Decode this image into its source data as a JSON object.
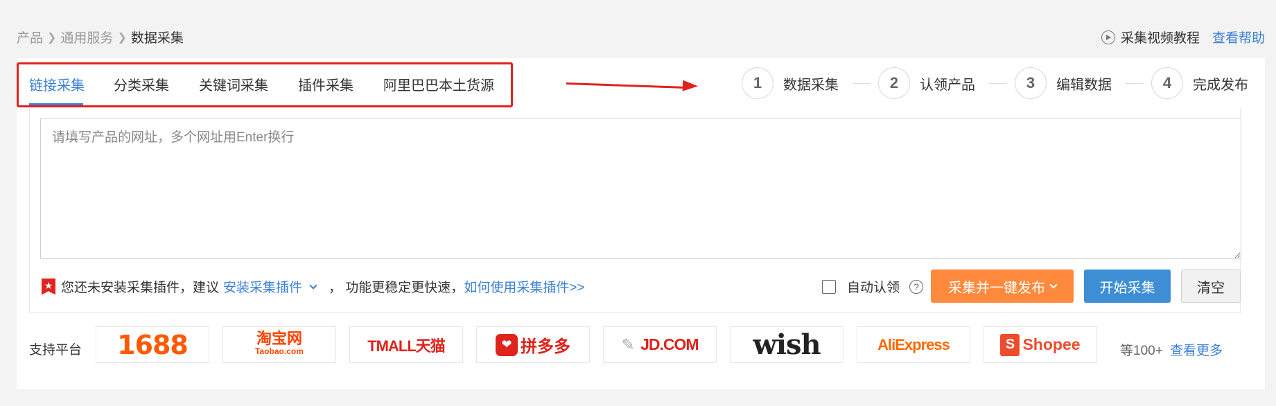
{
  "breadcrumb": {
    "items": [
      "产品",
      "通用服务"
    ],
    "current": "数据采集"
  },
  "header": {
    "tutorial_label": "采集视频教程",
    "help_label": "查看帮助"
  },
  "tabs": [
    {
      "label": "链接采集",
      "active": true
    },
    {
      "label": "分类采集",
      "active": false
    },
    {
      "label": "关键词采集",
      "active": false
    },
    {
      "label": "插件采集",
      "active": false
    },
    {
      "label": "阿里巴巴本土货源",
      "active": false
    }
  ],
  "steps": [
    {
      "number": "1",
      "label": "数据采集"
    },
    {
      "number": "2",
      "label": "认领产品"
    },
    {
      "number": "3",
      "label": "编辑数据"
    },
    {
      "number": "4",
      "label": "完成发布"
    }
  ],
  "url_input": {
    "placeholder": "请填写产品的网址，多个网址用Enter换行",
    "value": ""
  },
  "plugin_notice": {
    "prefix": "您还未安装采集插件，建议",
    "install_link": "安装采集插件",
    "middle": "，  功能更稳定更快速，",
    "howto_link": "如何使用采集插件>>"
  },
  "auto_claim": {
    "label": "自动认领",
    "checked": false
  },
  "buttons": {
    "collect_publish": "采集并一键发布",
    "start": "开始采集",
    "clear": "清空"
  },
  "platforms": {
    "label": "支持平台",
    "items": [
      {
        "name": "1688"
      },
      {
        "name": "淘宝网",
        "sub": "Taobao.com"
      },
      {
        "name": "TMALL天猫"
      },
      {
        "name": "拼多多"
      },
      {
        "name": "JD.COM"
      },
      {
        "name": "wish"
      },
      {
        "name": "AliExpress"
      },
      {
        "name": "Shopee"
      }
    ],
    "more_count": "等100+",
    "more_link": "查看更多"
  },
  "colors": {
    "accent": "#3a7fd5",
    "highlight_red": "#e0231c",
    "orange_button": "#ff8a3d",
    "blue_button": "#3d8ed5"
  }
}
